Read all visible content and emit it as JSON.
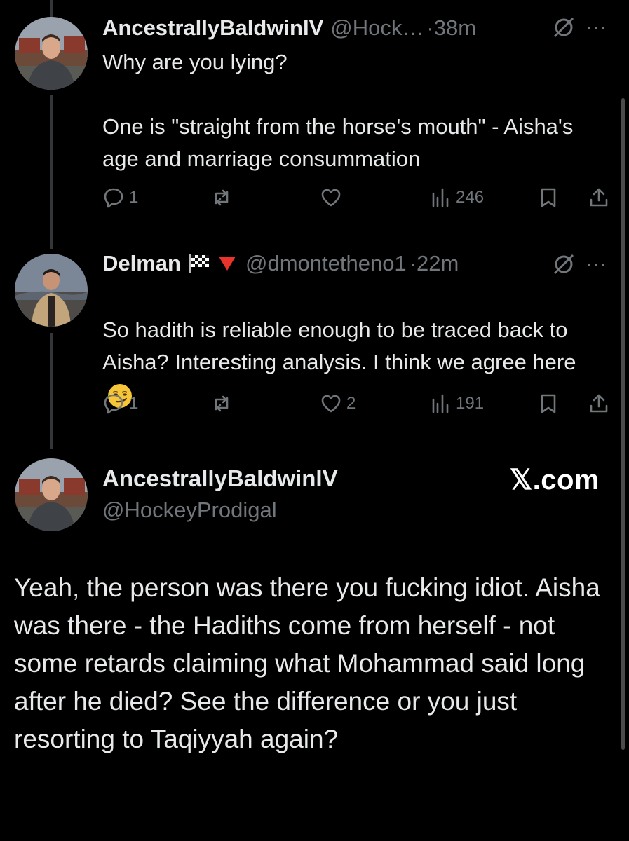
{
  "reply1": {
    "display_name": "AncestrallyBaldwinIV",
    "handle": "@Hock…",
    "time": "·38m",
    "text": "Why are you lying?\n\nOne is \"straight from the horse's mouth\" - Aisha's age and marriage consummation",
    "stats": {
      "replies": "1",
      "reposts": "",
      "likes": "",
      "views": "246"
    }
  },
  "reply2": {
    "display_name": "Delman",
    "handle": "@dmontetheno1",
    "time": "·22m",
    "text": "So hadith is reliable enough to be traced back to Aisha? Interesting analysis. I think we agree here",
    "stats": {
      "replies": "1",
      "reposts": "",
      "likes": "2",
      "views": "191"
    }
  },
  "main_post": {
    "display_name": "AncestrallyBaldwinIV",
    "handle": "@HockeyProdigal",
    "text": "Yeah, the person was there you fucking idiot. Aisha was there - the Hadiths come from herself - not some retards claiming what Mohammad said long after he died? See the difference or you just resorting to Taqiyyah again?"
  },
  "watermark": "𝕏.com",
  "icons": {
    "reply": "speech-bubble-icon",
    "repost": "repost-arrows-icon",
    "like": "heart-icon",
    "views": "bar-chart-icon",
    "bookmark": "bookmark-icon",
    "share": "share-upload-icon",
    "grok": "grok-slash-icon",
    "more": "ellipsis-icon"
  },
  "colors": {
    "background": "#000000",
    "text": "#e7e9ea",
    "muted": "#71767b",
    "flag_emoji_red": "#e8342b"
  }
}
